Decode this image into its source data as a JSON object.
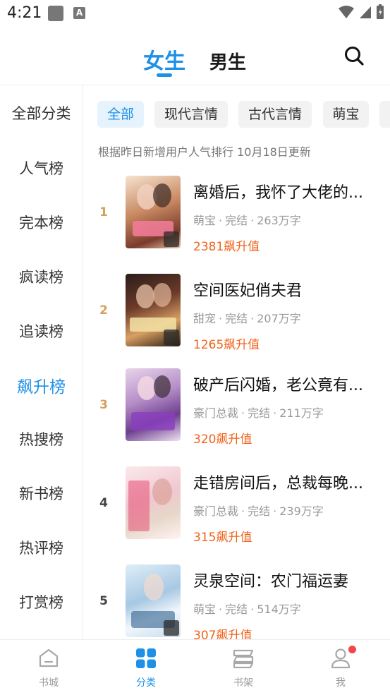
{
  "status_bar": {
    "time": "4:21"
  },
  "top_tabs": [
    {
      "label": "女生",
      "active": true
    },
    {
      "label": "男生",
      "active": false
    }
  ],
  "sidebar": {
    "header": "全部分类",
    "items": [
      "人气榜",
      "完本榜",
      "疯读榜",
      "追读榜",
      "飙升榜",
      "热搜榜",
      "新书榜",
      "热评榜",
      "打赏榜"
    ],
    "active_index": 4
  },
  "chips": [
    "全部",
    "现代言情",
    "古代言情",
    "萌宝"
  ],
  "info_line": "根据昨日新增用户人气排行 10月18日更新",
  "books": [
    {
      "rank": "1",
      "title": "离婚后，我怀了大佬的...",
      "genre": "萌宝",
      "status": "完结",
      "words": "263万字",
      "score": "2381飙升值"
    },
    {
      "rank": "2",
      "title": "空间医妃俏夫君",
      "genre": "甜宠",
      "status": "完结",
      "words": "207万字",
      "score": "1265飙升值"
    },
    {
      "rank": "3",
      "title": "破产后闪婚，老公竟有...",
      "genre": "豪门总裁",
      "status": "完结",
      "words": "211万字",
      "score": "320飙升值"
    },
    {
      "rank": "4",
      "title": "走错房间后，总裁每晚...",
      "genre": "豪门总裁",
      "status": "完结",
      "words": "239万字",
      "score": "315飙升值"
    },
    {
      "rank": "5",
      "title": "灵泉空间：农门福运妻",
      "genre": "萌宝",
      "status": "完结",
      "words": "514万字",
      "score": "307飙升值"
    }
  ],
  "bottom_tabs": [
    {
      "label": "书城",
      "icon": "home-icon"
    },
    {
      "label": "分类",
      "icon": "category-icon",
      "active": true
    },
    {
      "label": "书架",
      "icon": "bookshelf-icon"
    },
    {
      "label": "我",
      "icon": "profile-icon"
    }
  ],
  "colors": {
    "accent": "#1e90e6",
    "score": "#f0631b",
    "rank_top": "#d4a05c"
  }
}
